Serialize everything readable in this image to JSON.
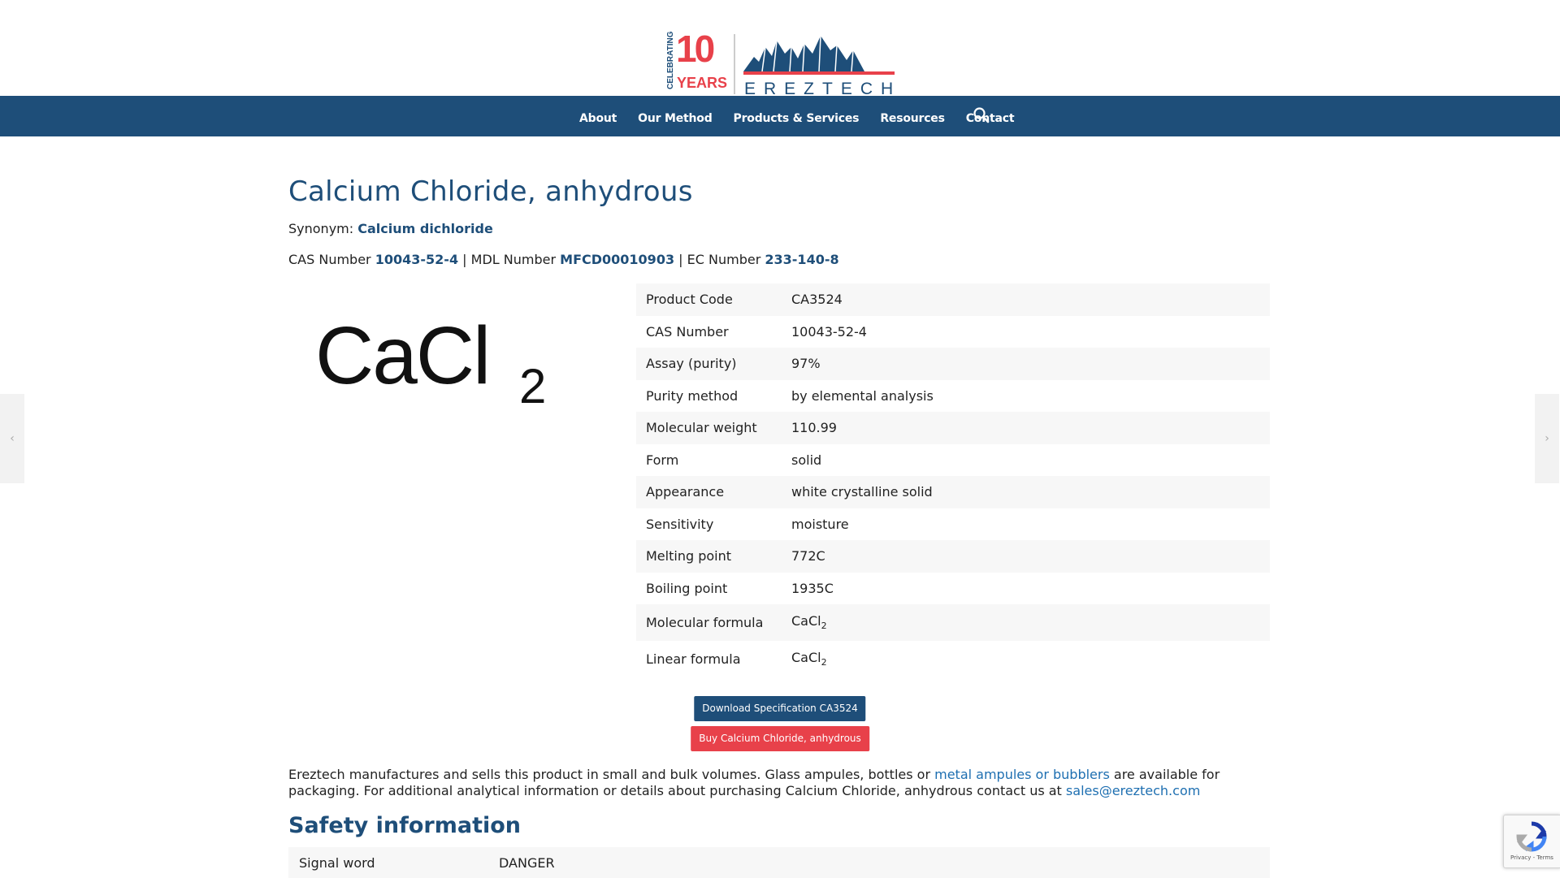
{
  "header": {
    "logo": {
      "celebrating": "CELEBRATING",
      "number": "10",
      "years": "YEARS",
      "brand": "EREZTECH"
    },
    "colors": {
      "brand_blue": "#1e4e79",
      "brand_red": "#e8414a",
      "link_blue": "#1e6fb1"
    }
  },
  "nav": {
    "items": [
      {
        "label": "About"
      },
      {
        "label": "Our Method"
      },
      {
        "label": "Products & Services"
      },
      {
        "label": "Resources"
      },
      {
        "label": "Contact"
      }
    ],
    "search_icon": "search-icon"
  },
  "product": {
    "title": "Calcium Chloride, anhydrous",
    "synonym_label": "Synonym:",
    "synonym": "Calcium dichloride",
    "cas_label": "CAS Number",
    "cas": "10043-52-4",
    "mdl_label": "| MDL Number",
    "mdl": "MFCD00010903",
    "ec_label": "| EC Number",
    "ec": "233-140-8",
    "formula_image": {
      "main": "CaCl",
      "sub": "2"
    }
  },
  "spec_table": [
    {
      "key": "Product Code",
      "value": "CA3524"
    },
    {
      "key": "CAS Number",
      "value": "10043-52-4"
    },
    {
      "key": "Assay (purity)",
      "value": "97%"
    },
    {
      "key": "Purity method",
      "value": "by elemental analysis"
    },
    {
      "key": "Molecular weight",
      "value": "110.99"
    },
    {
      "key": "Form",
      "value": "solid"
    },
    {
      "key": "Appearance",
      "value": "white crystalline solid"
    },
    {
      "key": "Sensitivity",
      "value": "moisture"
    },
    {
      "key": "Melting point",
      "value": "772C"
    },
    {
      "key": "Boiling point",
      "value": "1935C"
    },
    {
      "key": "Molecular formula",
      "value": "CaCl",
      "sub": "2"
    },
    {
      "key": "Linear formula",
      "value": "CaCl",
      "sub": "2"
    }
  ],
  "buttons": {
    "download": "Download Specification CA3524",
    "buy": "Buy Calcium Chloride, anhydrous"
  },
  "description": {
    "text1": "Ereztech manufactures and sells this product in small and bulk volumes. Glass ampules, bottles or ",
    "link1": "metal ampules or bubblers",
    "text2": " are available for packaging. For additional analytical information or details about purchasing Calcium Chloride, anhydrous contact us at ",
    "email": "sales@ereztech.com"
  },
  "safety": {
    "title": "Safety information",
    "rows": [
      {
        "key": "Signal word",
        "value": "DANGER"
      }
    ]
  },
  "side_nav": {
    "prev": "‹",
    "next": "›"
  },
  "recaptcha": {
    "footer": "Privacy - Terms"
  }
}
